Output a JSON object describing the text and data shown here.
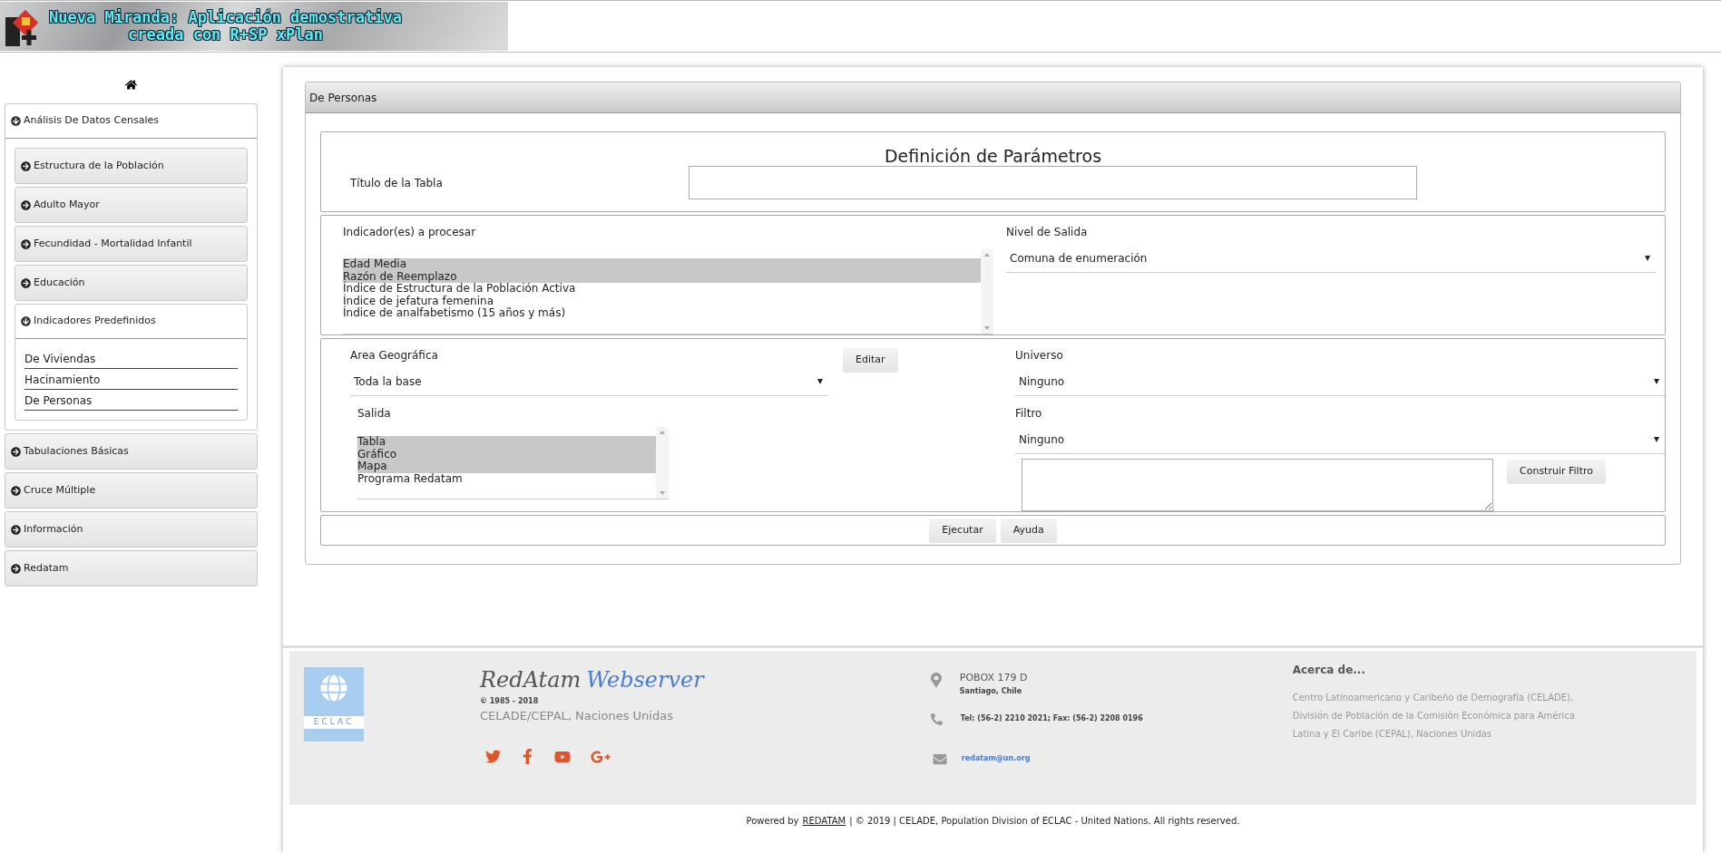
{
  "header": {
    "title_line_1": "Nueva Miranda: Aplicación demostrativa",
    "title_line_2": "creada con R+SP xPlan"
  },
  "sidebar": {
    "sections": [
      {
        "label": "Análisis De Datos Censales",
        "expanded": true,
        "children": [
          {
            "label": "Estructura de la Población",
            "expanded": false
          },
          {
            "label": "Adulto Mayor",
            "expanded": false
          },
          {
            "label": "Fecundidad - Mortalidad Infantil",
            "expanded": false
          },
          {
            "label": "Educación",
            "expanded": false
          },
          {
            "label": "Indicadores Predefinidos",
            "expanded": true,
            "children": [
              {
                "label": "De Viviendas"
              },
              {
                "label": "Hacinamiento"
              },
              {
                "label": "De Personas"
              }
            ]
          }
        ]
      },
      {
        "label": "Tabulaciones Básicas",
        "expanded": false
      },
      {
        "label": "Cruce Múltiple",
        "expanded": false
      },
      {
        "label": "Información",
        "expanded": false
      },
      {
        "label": "Redatam",
        "expanded": false
      }
    ]
  },
  "panel": {
    "title": "De Personas",
    "heading": "Definición de Parámetros",
    "table_title": {
      "label": "Título de la Tabla"
    },
    "indicators": {
      "label": "Indicador(es) a procesar",
      "options": [
        {
          "label": "Edad Media",
          "selected": true
        },
        {
          "label": "Razón de Reemplazo",
          "selected": true
        },
        {
          "label": "Índice de Estructura de la Población Activa",
          "selected": false
        },
        {
          "label": "Índice de jefatura femenina",
          "selected": false
        },
        {
          "label": "Índice de analfabetismo (15 años y más)",
          "selected": false
        }
      ]
    },
    "output_level": {
      "label": "Nivel de Salida",
      "value": "Comuna de enumeración"
    },
    "area": {
      "label": "Area Geográfica",
      "value": "Toda la base",
      "button": "Editar"
    },
    "output": {
      "label": "Salida",
      "options": [
        {
          "label": "Tabla",
          "selected": true
        },
        {
          "label": "Gráfico",
          "selected": true
        },
        {
          "label": "Mapa",
          "selected": true
        },
        {
          "label": "Programa Redatam",
          "selected": false
        }
      ]
    },
    "universe": {
      "label": "Universo",
      "value": "Ninguno"
    },
    "filter": {
      "label": "Filtro",
      "value": "Ninguno",
      "button": "Construir Filtro"
    },
    "actions": [
      "Ejecutar",
      "Ayuda"
    ]
  },
  "footer": {
    "emblem_text": "ECLAC",
    "brand_1": "RedAtam",
    "brand_2": "Webserver",
    "years": "© 1985 - 2018",
    "org": "CELADE/CEPAL, Naciones Unidas",
    "address": "POBOX 179 D",
    "city": "Santiago, Chile",
    "phone": "Tel: (56-2) 2210 2021; Fax: (56-2) 2208 0196",
    "email": "redatam@un.org",
    "about_title": "Acerca de...",
    "about_lines": [
      "Centro Latinoamericano y Caribeño de Demografía (CELADE),",
      "División de Población de la Comisión Económica para América",
      "Latina y El Caribe (CEPAL), Naciones Unidas"
    ],
    "powered_prefix": "Powered by",
    "powered_link": "REDATAM",
    "powered_rest": "| © 2019 | CELADE, Population Division of ECLAC - United Nations. All rights reserved."
  }
}
